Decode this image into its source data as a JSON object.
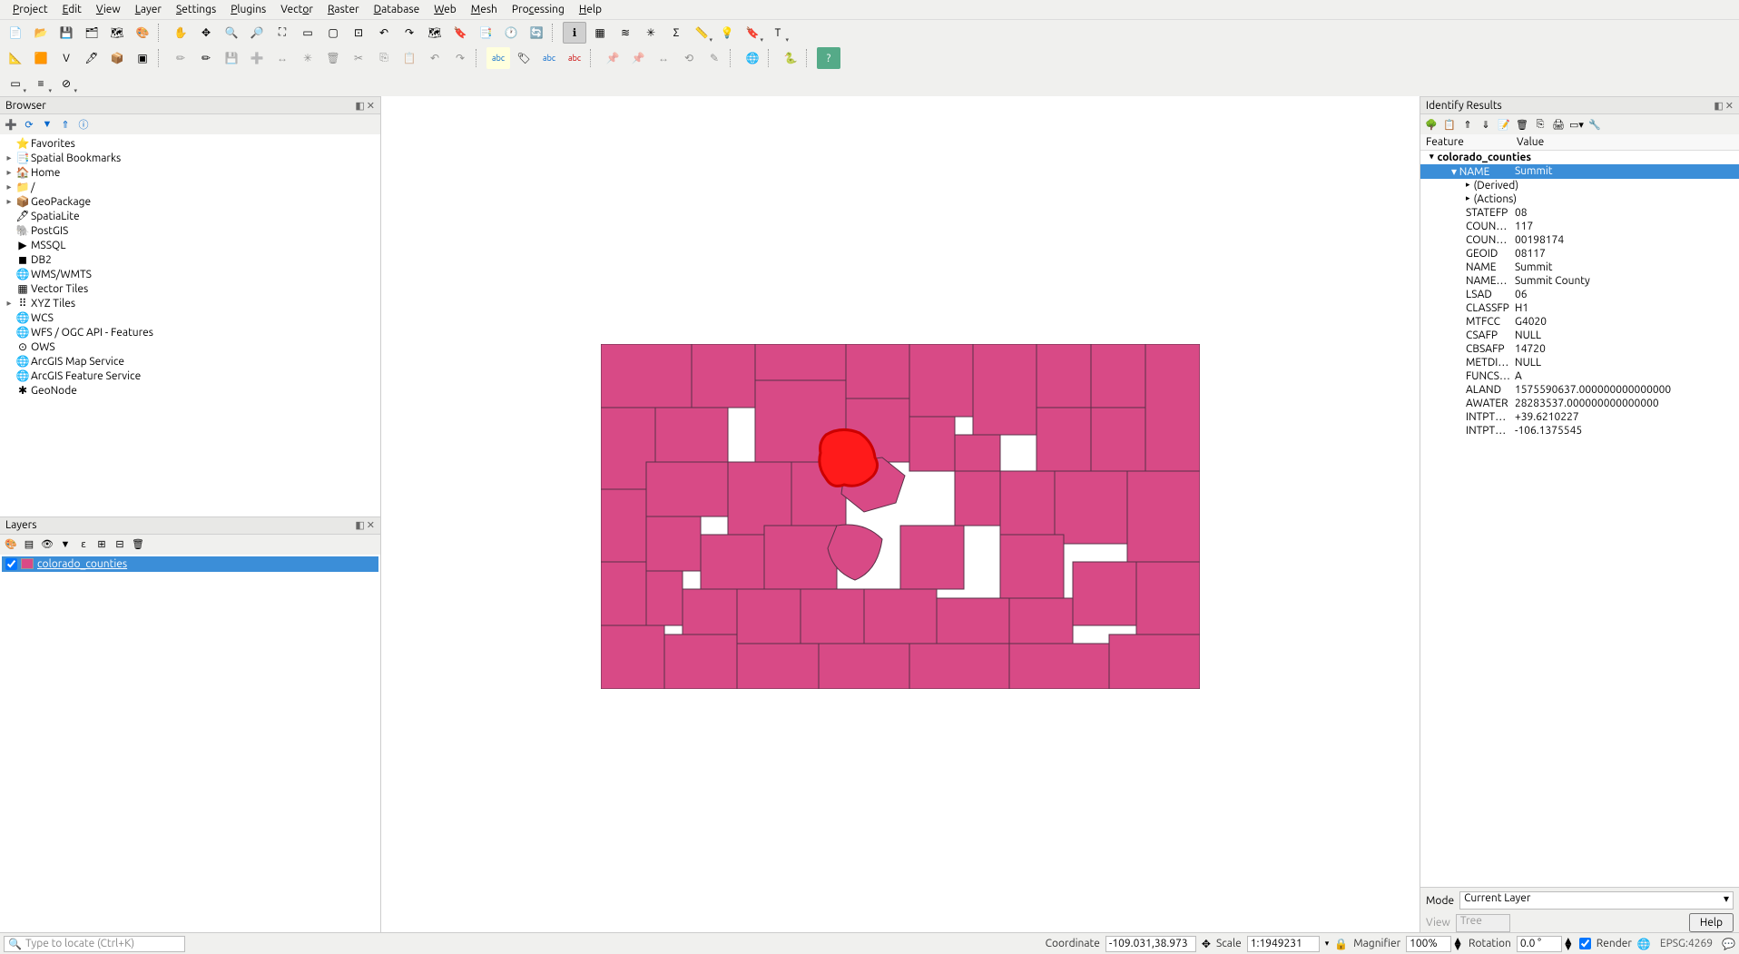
{
  "menu": [
    "Project",
    "Edit",
    "View",
    "Layer",
    "Settings",
    "Plugins",
    "Vector",
    "Raster",
    "Database",
    "Web",
    "Mesh",
    "Processing",
    "Help"
  ],
  "panels": {
    "browser": {
      "title": "Browser",
      "items": [
        {
          "exp": "",
          "ico": "⭐",
          "label": "Favorites"
        },
        {
          "exp": "▸",
          "ico": "📑",
          "label": "Spatial Bookmarks"
        },
        {
          "exp": "▸",
          "ico": "🏠",
          "label": "Home"
        },
        {
          "exp": "▸",
          "ico": "📁",
          "label": "/"
        },
        {
          "exp": "▸",
          "ico": "📦",
          "label": "GeoPackage"
        },
        {
          "exp": "",
          "ico": "🖋",
          "label": "SpatiaLite"
        },
        {
          "exp": "",
          "ico": "🐘",
          "label": "PostGIS"
        },
        {
          "exp": "",
          "ico": "▶",
          "label": "MSSQL"
        },
        {
          "exp": "",
          "ico": "◼",
          "label": "DB2"
        },
        {
          "exp": "",
          "ico": "🌐",
          "label": "WMS/WMTS"
        },
        {
          "exp": "",
          "ico": "▦",
          "label": "Vector Tiles"
        },
        {
          "exp": "▸",
          "ico": "⠿",
          "label": "XYZ Tiles"
        },
        {
          "exp": "",
          "ico": "🌐",
          "label": "WCS"
        },
        {
          "exp": "",
          "ico": "🌐",
          "label": "WFS / OGC API - Features"
        },
        {
          "exp": "",
          "ico": "⊙",
          "label": "OWS"
        },
        {
          "exp": "",
          "ico": "🌐",
          "label": "ArcGIS Map Service"
        },
        {
          "exp": "",
          "ico": "🌐",
          "label": "ArcGIS Feature Service"
        },
        {
          "exp": "",
          "ico": "✱",
          "label": "GeoNode"
        }
      ]
    },
    "layers": {
      "title": "Layers",
      "layer_name": "colorado_counties",
      "checked": true
    },
    "identify": {
      "title": "Identify Results",
      "head_feature": "Feature",
      "head_value": "Value",
      "layer": "colorado_counties",
      "selected_field": "NAME",
      "selected_value": "Summit",
      "derived": "(Derived)",
      "actions": "(Actions)",
      "attrs": [
        {
          "f": "STATEFP",
          "v": "08"
        },
        {
          "f": "COUNT…",
          "v": "117"
        },
        {
          "f": "COUNT…",
          "v": "00198174"
        },
        {
          "f": "GEOID",
          "v": "08117"
        },
        {
          "f": "NAME",
          "v": "Summit"
        },
        {
          "f": "NAMEL…",
          "v": "Summit County"
        },
        {
          "f": "LSAD",
          "v": "06"
        },
        {
          "f": "CLASSFP",
          "v": "H1"
        },
        {
          "f": "MTFCC",
          "v": "G4020"
        },
        {
          "f": "CSAFP",
          "v": "NULL"
        },
        {
          "f": "CBSAFP",
          "v": "14720"
        },
        {
          "f": "METDI…",
          "v": "NULL"
        },
        {
          "f": "FUNCS…",
          "v": "A"
        },
        {
          "f": "ALAND",
          "v": "1575590637.000000000000000"
        },
        {
          "f": "AWATER",
          "v": "28283537.000000000000000"
        },
        {
          "f": "INTPTL…",
          "v": "+39.6210227"
        },
        {
          "f": "INTPTL…",
          "v": "-106.1375545"
        }
      ],
      "mode_label": "Mode",
      "mode_value": "Current Layer",
      "view_label": "View",
      "view_value": "Tree",
      "help": "Help"
    }
  },
  "status": {
    "search_placeholder": "Type to locate (Ctrl+K)",
    "coord_label": "Coordinate",
    "coord": "-109.031,38.973",
    "scale_label": "Scale",
    "scale": "1:1949231",
    "lock": "🔒",
    "mag_label": "Magnifier",
    "mag": "100%",
    "rot_label": "Rotation",
    "rot": "0.0 °",
    "render": "Render",
    "crs": "EPSG:4269"
  },
  "icons": {
    "new": "📄",
    "open": "📂",
    "save": "💾",
    "saveas": "📑",
    "layout": "🗂",
    "layout_mgr": "🗂",
    "pan": "✋",
    "pan_sel": "✥",
    "zoomin": "🔍+",
    "zoomout": "🔍-",
    "zoomfull": "⛶",
    "zoomsel": "🔍▭",
    "zoomlayer": "🔍▢",
    "zoomnative": "🔍",
    "zoomlast": "↶",
    "zoomnext": "↷",
    "newmap": "🗺",
    "newbm": "📑",
    "showbm": "📑",
    "temporal": "🕐",
    "refresh": "🔄",
    "identify": "ℹ",
    "attrtable": "▦",
    "stats": "≋",
    "options": "✳",
    "sigma": "Σ",
    "measure": "📏",
    "tip": "💡",
    "annot": "🔖",
    "text": "T",
    "vlayer": "V",
    "raster": "R",
    "mesh": "M",
    "delim": "📋",
    "spatialite": "🖋",
    "virtual": "V",
    "edit": "✏",
    "saveedit": "💾",
    "featadd": "➕",
    "vertex": "✳",
    "deletesel": "🗑",
    "cut": "✂",
    "copy": "⎘",
    "paste": "📋",
    "undo": "↶",
    "redo": "↷",
    "label": "abc",
    "labellayer": "abc",
    "diagram": "◔",
    "pin": "📌",
    "metasearch": "🌐",
    "python": "🐍",
    "help": "❓"
  }
}
